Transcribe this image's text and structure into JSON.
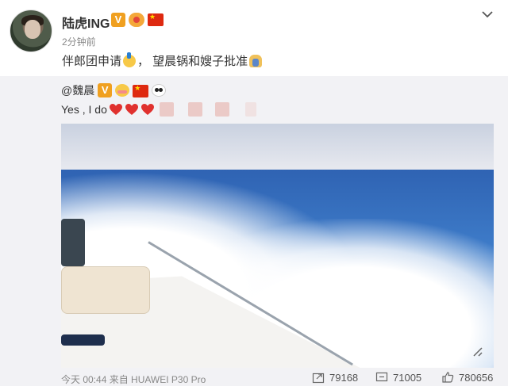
{
  "post": {
    "author": "陆虎ING",
    "timestamp": "2分钟前",
    "text": "伴郎团申请",
    "text_after": "，  望晨锅和嫂子批准",
    "badge_v": "V",
    "flag_alt": "china-flag"
  },
  "repost": {
    "author": "@魏晨",
    "badge_v": "V",
    "text": "Yes , I do"
  },
  "footer": {
    "time": "今天 00:44 来自 HUAWEI P30 Pro",
    "reposts": "79168",
    "comments": "71005",
    "likes": "780656"
  },
  "colors": {
    "accent_orange": "#f0a020",
    "heart_red": "#e0312e",
    "repost_bg": "#f2f2f5"
  },
  "icons": [
    "chevron-down-icon",
    "fullscreen-icon",
    "repost-icon",
    "comment-icon",
    "like-icon"
  ]
}
